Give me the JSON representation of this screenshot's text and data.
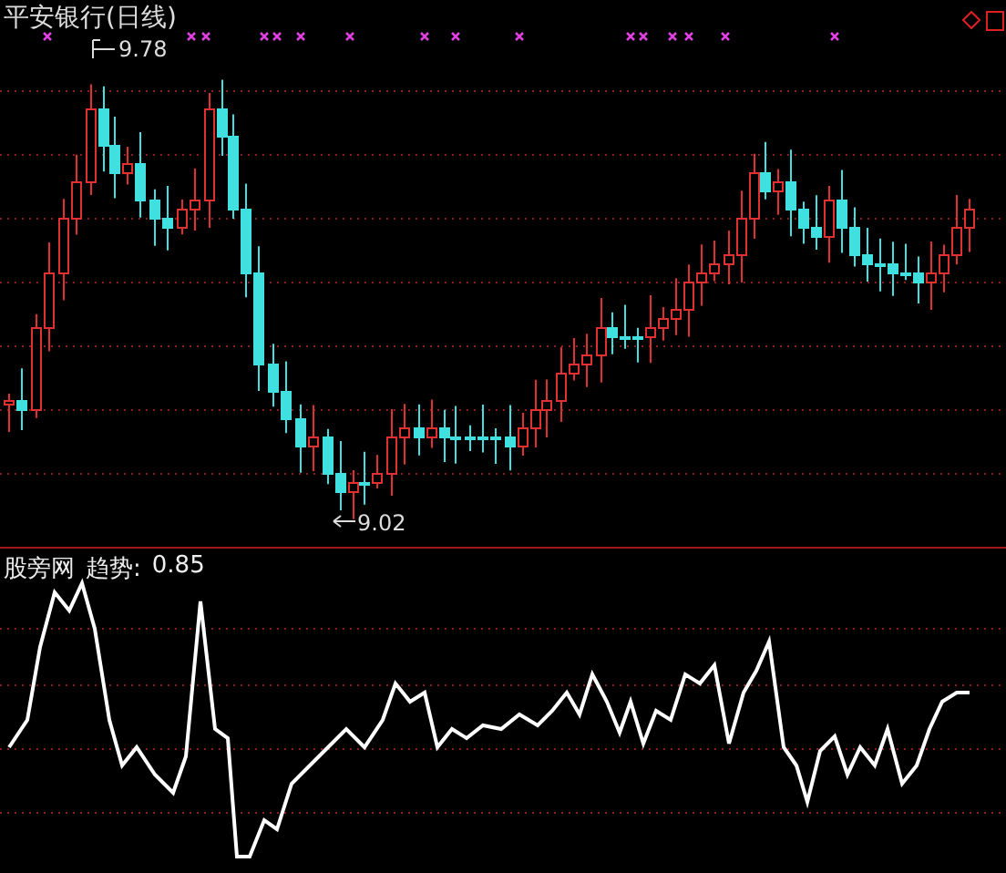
{
  "chart": {
    "title": "平安银行(日线)",
    "high_label": "9.78",
    "low_label": "9.02"
  },
  "indicator": {
    "name": "股旁网",
    "label": "趋势:",
    "value": "0.85"
  }
}
